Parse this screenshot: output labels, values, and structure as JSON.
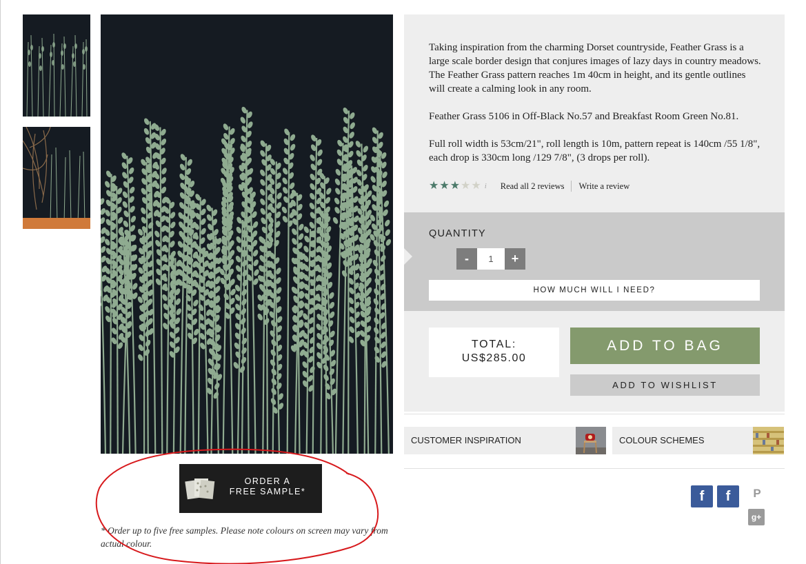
{
  "product": {
    "description": [
      "Taking inspiration from the charming Dorset countryside, Feather Grass is a large scale border design that conjures images of lazy days in country meadows. The Feather Grass pattern reaches 1m 40cm in height, and its gentle outlines will create a calming look in any room.",
      "Feather Grass 5106 in Off-Black No.57 and Breakfast Room Green No.81.",
      "Full roll width is 53cm/21\", roll length is 10m, pattern repeat is 140cm /55 1/8\", each drop is 330cm long /129 7/8\", (3 drops per roll)."
    ],
    "rating": {
      "stars": 3,
      "max": 5,
      "info_icon": "i",
      "read_reviews": "Read all 2 reviews",
      "write_review": "Write a review"
    }
  },
  "quantity": {
    "label": "QUANTITY",
    "minus": "-",
    "plus": "+",
    "value": "1",
    "how_much": "HOW MUCH WILL I NEED?"
  },
  "purchase": {
    "total_label": "TOTAL:",
    "total_value": "US$285.00",
    "add_to_bag": "ADD TO BAG",
    "add_to_wishlist": "ADD TO WISHLIST"
  },
  "tiles": {
    "inspiration": "CUSTOMER INSPIRATION",
    "colours": "COLOUR SCHEMES"
  },
  "sample": {
    "line1": "ORDER A",
    "line2": "FREE SAMPLE*",
    "note": "* Order up to five free samples. Please note colours on screen may vary from actual colour."
  },
  "social": {
    "facebook": "f",
    "pinterest": "P",
    "google_plus": "g+"
  },
  "colors": {
    "wallpaper_background": "#151b22",
    "grass": "#8fab90",
    "rating_star": "#4c7a6a",
    "add_to_bag": "#849a6d",
    "facebook": "#3b5b9a",
    "annotation": "#d7191c"
  },
  "icons": [
    "info-icon",
    "star-icon",
    "sample-swatch-icon",
    "facebook-icon",
    "pinterest-icon",
    "google-plus-icon"
  ]
}
